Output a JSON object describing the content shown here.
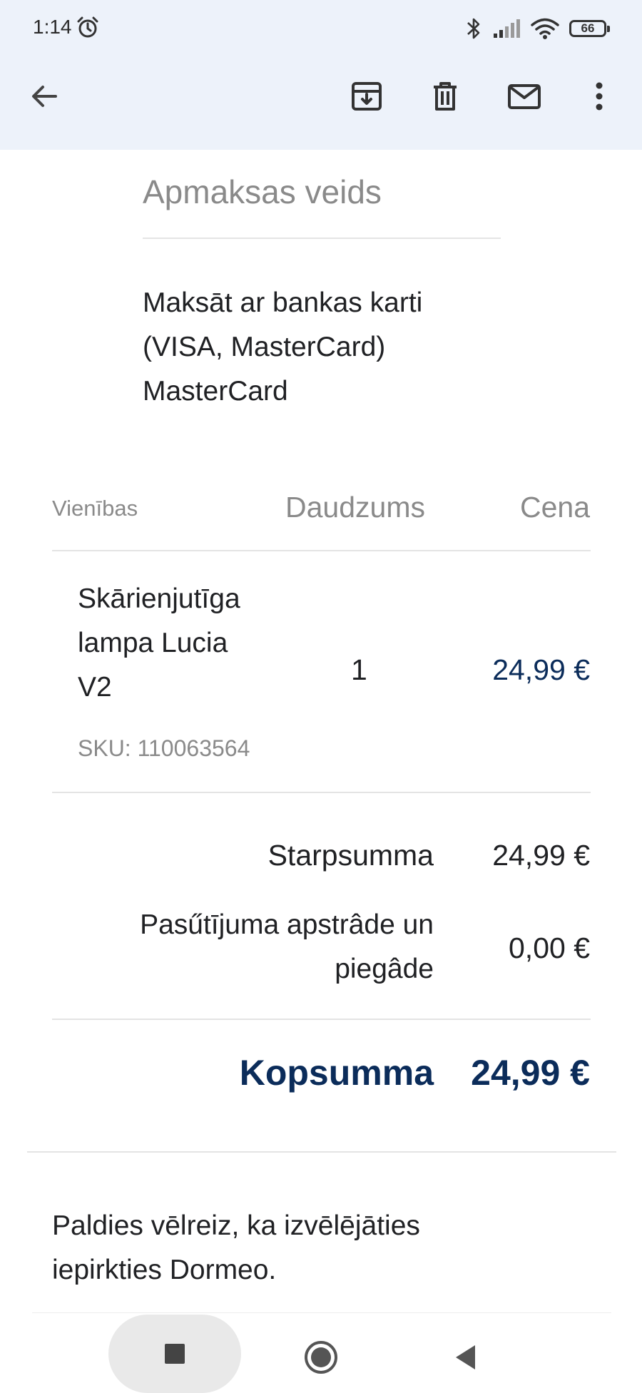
{
  "status_bar": {
    "time": "1:14",
    "battery": "66",
    "icons": [
      "alarm-icon",
      "bluetooth-icon",
      "signal-icon",
      "wifi-icon",
      "battery-icon"
    ]
  },
  "app_bar": {
    "actions": [
      "back-arrow-icon",
      "archive-icon",
      "delete-icon",
      "mark-unread-icon",
      "more-vert-icon"
    ]
  },
  "payment": {
    "heading": "Apmaksas veids",
    "lines": [
      "Maksāt ar bankas karti",
      "(VISA, MasterCard)",
      "MasterCard"
    ]
  },
  "table": {
    "headers": {
      "item": "Vienības",
      "qty": "Daudzums",
      "price": "Cena"
    },
    "rows": [
      {
        "name_lines": [
          "Skārienjutīga",
          "lampa Lucia",
          "V2"
        ],
        "sku": "SKU: 110063564",
        "qty": "1",
        "price": "24,99 €"
      }
    ]
  },
  "totals": {
    "subtotal_label": "Starpsumma",
    "subtotal_value": "24,99 €",
    "shipping_label_lines": [
      "Pasűtījuma apstrâde un",
      "piegâde"
    ],
    "shipping_value": "0,00 €",
    "total_label": "Kopsumma",
    "total_value": "24,99 €"
  },
  "thanks": {
    "lines": [
      "Paldies vēlreiz, ka izvēlējāties",
      "iepirkties Dormeo."
    ]
  },
  "colors": {
    "appbar_bg": "#edf2fa",
    "navy": "#0b2c5a",
    "muted": "#8a8a8a"
  },
  "nav_bar": {
    "buttons": [
      "recents-square-icon",
      "home-circle-icon",
      "back-triangle-icon"
    ]
  }
}
